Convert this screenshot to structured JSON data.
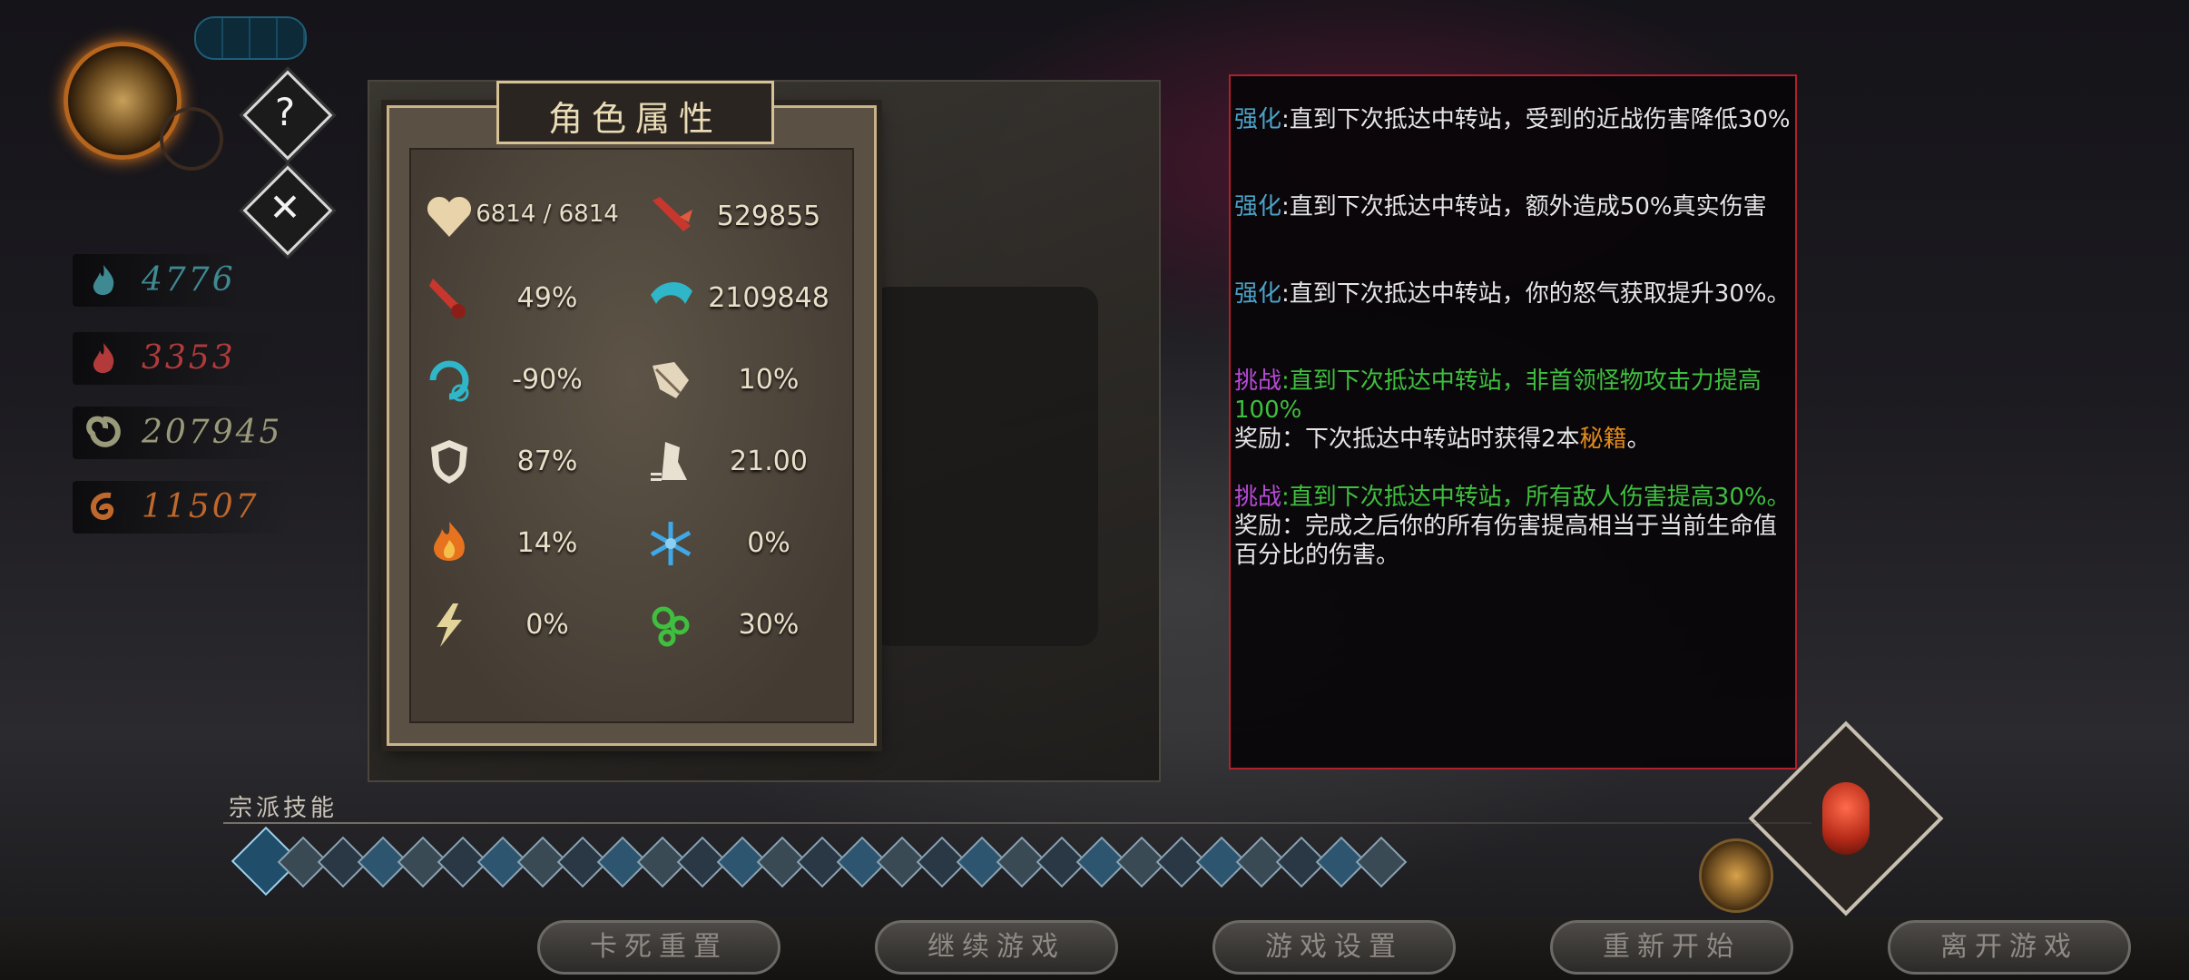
{
  "resources": [
    {
      "icon": "teal-flame-icon",
      "value": "4776",
      "color": "#3f8a92"
    },
    {
      "icon": "red-flame-icon",
      "value": "3353",
      "color": "#b23a3a"
    },
    {
      "icon": "green-spiral-icon",
      "value": "207945",
      "color": "#9a9a7a"
    },
    {
      "icon": "orange-swirl-icon",
      "value": "11507",
      "color": "#c0682c"
    }
  ],
  "top_controls": {
    "help_label": "?",
    "close_label": "✕"
  },
  "stats_panel": {
    "title": "角色属性",
    "stats": [
      {
        "icon": "heart-icon",
        "value": "6814 / 6814"
      },
      {
        "icon": "attack-icon",
        "value": "529855"
      },
      {
        "icon": "crit-chance-icon",
        "value": "49%"
      },
      {
        "icon": "crit-damage-icon",
        "value": "2109848"
      },
      {
        "icon": "cooldown-icon",
        "value": "-90%"
      },
      {
        "icon": "dodge-icon",
        "value": "10%"
      },
      {
        "icon": "shield-icon",
        "value": "87%"
      },
      {
        "icon": "speed-icon",
        "value": "21.00"
      },
      {
        "icon": "fire-icon",
        "value": "14%"
      },
      {
        "icon": "ice-icon",
        "value": "0%"
      },
      {
        "icon": "lightning-icon",
        "value": "0%"
      },
      {
        "icon": "poison-icon",
        "value": "30%"
      }
    ]
  },
  "effects_panel": {
    "entries": [
      {
        "tag": "强化",
        "text": ":直到下次抵达中转站，受到的近战伤害降低30%"
      },
      {
        "tag": "强化",
        "text": ":直到下次抵达中转站，额外造成50%真实伤害"
      },
      {
        "tag": "强化",
        "text": ":直到下次抵达中转站，你的怒气获取提升30%。"
      },
      {
        "tag": "挑战",
        "text": ":直到下次抵达中转站，非首领怪物攻击力提高100%",
        "reward_prefix": "奖励：下次抵达中转站时获得2本",
        "reward_highlight": "秘籍",
        "reward_suffix": "。"
      },
      {
        "tag": "挑战",
        "text": ":直到下次抵达中转站，所有敌人伤害提高30%。",
        "reward_prefix": "奖励：完成之后你的所有伤害提高相当于当前生命值百分比的伤害。"
      }
    ]
  },
  "skills": {
    "label": "宗派技能",
    "count": 29
  },
  "bottom_buttons": [
    {
      "label": "卡死重置"
    },
    {
      "label": "继续游戏"
    },
    {
      "label": "游戏设置"
    },
    {
      "label": "重新开始"
    },
    {
      "label": "离开游戏"
    }
  ]
}
